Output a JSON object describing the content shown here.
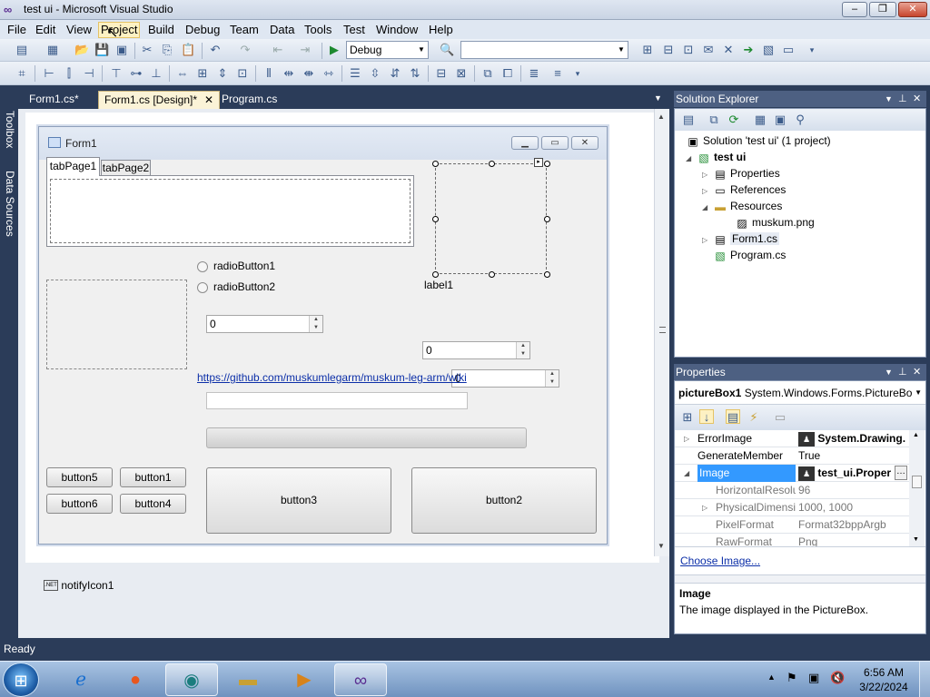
{
  "window": {
    "title": "test ui - Microsoft Visual Studio"
  },
  "menu": [
    "File",
    "Edit",
    "View",
    "Project",
    "Build",
    "Debug",
    "Team",
    "Data",
    "Tools",
    "Test",
    "Window",
    "Help"
  ],
  "toolbar": {
    "config_value": "Debug",
    "platform_value": ""
  },
  "siderail": {
    "toolbox": "Toolbox",
    "datasources": "Data Sources"
  },
  "doctabs": {
    "tab1": "Form1.cs*",
    "tab2": "Form1.cs [Design]*",
    "tab3": "Program.cs"
  },
  "form": {
    "title": "Form1",
    "tabpage1": "tabPage1",
    "tabpage2": "tabPage2",
    "radio1": "radioButton1",
    "radio2": "radioButton2",
    "label1": "label1",
    "numeric1": "0",
    "numeric2": "0",
    "numeric3": "0",
    "link": "https://github.com/muskumlegarm/muskum-leg-arm/wiki",
    "button1": "button1",
    "button2": "button2",
    "button3": "button3",
    "button4": "button4",
    "button5": "button5",
    "button6": "button6"
  },
  "tray_component": "notifyIcon1",
  "solution_explorer": {
    "title": "Solution Explorer",
    "nodes": {
      "solution": "Solution 'test ui' (1 project)",
      "project": "test ui",
      "properties": "Properties",
      "references": "References",
      "resources": "Resources",
      "muskum": "muskum.png",
      "form1": "Form1.cs",
      "program": "Program.cs"
    }
  },
  "properties": {
    "title": "Properties",
    "object": "pictureBox1",
    "type": "System.Windows.Forms.PictureBo",
    "rows": {
      "errorimage": {
        "name": "ErrorImage",
        "value": "System.Drawing."
      },
      "generatemember": {
        "name": "GenerateMember",
        "value": "True"
      },
      "image": {
        "name": "Image",
        "value": "test_ui.Proper"
      },
      "hres": {
        "name": "HorizontalResolu",
        "value": "96"
      },
      "physdim": {
        "name": "PhysicalDimensi",
        "value": "1000, 1000"
      },
      "pixfmt": {
        "name": "PixelFormat",
        "value": "Format32bppArgb"
      },
      "rawfmt": {
        "name": "RawFormat",
        "value": "Png"
      }
    },
    "choose_image": "Choose Image...",
    "desc_title": "Image",
    "desc_text": "The image displayed in the PictureBox."
  },
  "status": {
    "text": "Ready"
  },
  "clock": {
    "time": "6:56 AM",
    "date": "3/22/2024"
  }
}
